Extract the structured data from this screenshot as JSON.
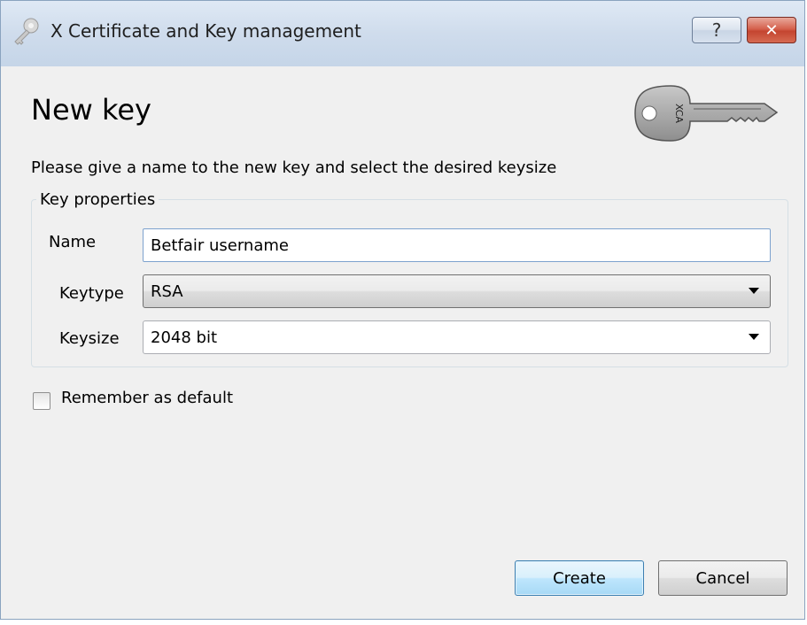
{
  "window": {
    "title": "X Certificate and Key management",
    "help_label": "?",
    "close_label": "✕"
  },
  "page": {
    "heading": "New key",
    "description": "Please give a name to the new key and select the desired keysize",
    "logo_icon": "key-icon",
    "logo_text": "XCA"
  },
  "key_properties": {
    "legend": "Key properties",
    "name_label": "Name",
    "name_value": "Betfair username",
    "keytype_label": "Keytype",
    "keytype_value": "RSA",
    "keysize_label": "Keysize",
    "keysize_value": "2048 bit"
  },
  "options": {
    "remember_label": "Remember as default",
    "remember_checked": false
  },
  "buttons": {
    "create": "Create",
    "cancel": "Cancel"
  }
}
